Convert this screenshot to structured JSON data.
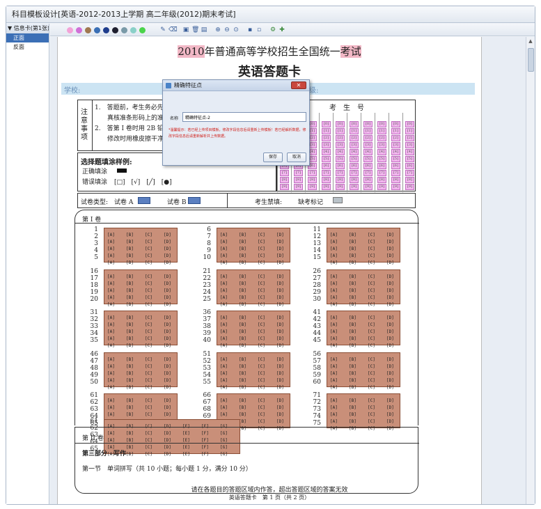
{
  "window": {
    "title": "科目模板设计[英语-2012-2013上学期 高二年级(2012)期末考试]"
  },
  "sidebar": {
    "header": "▼ 信息卡(第1张)",
    "items": [
      {
        "label": "正面",
        "selected": true
      },
      {
        "label": "反面",
        "selected": false
      }
    ]
  },
  "toolbar": {
    "colors": [
      "#f3a3d8",
      "#d070d8",
      "#a07850",
      "#3a6fb5",
      "#1f3d8c",
      "#1f1f2f",
      "#7a9aa8",
      "#8ad0c8",
      "#4bd44b"
    ],
    "icons": [
      "pencil-icon",
      "eraser-icon",
      "folder-icon",
      "trash-icon",
      "delete-icon",
      "zoom-in-icon",
      "zoom-out-icon",
      "zoom-fit-icon",
      "save-icon",
      "save-as-icon",
      "settings-icon",
      "add-icon"
    ]
  },
  "sheet": {
    "title_year": "2010",
    "title_main": "年普通高等学校招生全国统一",
    "title_tail": "考试",
    "subtitle": "英语答题卡",
    "school_label": "学校:",
    "class_label": "班级:",
    "notice_title": "注意事项",
    "notice_lines": [
      "1.　答题前，考生务必先",
      "　　真核准条形码上的准",
      "2.　答第 I 卷时用 2B 铅",
      "　　修改时用橡皮擦干净"
    ],
    "exam_no_title": "考　生　号",
    "sample_title": "选择题填涂样例:",
    "sample_correct": "正确填涂",
    "sample_wrong": "错误填涂",
    "sample_wrong_marks": "[□]　[√]　[╱]　[●]",
    "type_label": "试卷类型:",
    "type_a": "试卷 A",
    "type_b": "试卷 B",
    "forbid_label": "考生禁填:",
    "absent_label": "缺考标记",
    "part1_title": "第 I 卷",
    "part2_title": "第 II 卷",
    "part3_title": "第三部分　写作",
    "section1": "第一节　单词拼写（共 10 小题；每小题 1 分，满分 10 分）",
    "bottom_note": "请在各题目的答题区域内作答，超出答题区域的答案无效",
    "footer": "英语答题卡　第 1 页（共 2 页）",
    "options_abcd": [
      "[A]",
      "[B]",
      "[C]",
      "[D]"
    ],
    "options_abcdefg": [
      "[A]",
      "[B]",
      "[C]",
      "[D]",
      "[E]",
      "[F]",
      "[G]"
    ]
  },
  "dialog": {
    "title": "精确特征点",
    "name_label": "名称",
    "name_value": "精确特征点-2",
    "warning": "*温馨提示：若已经上传项目模板，修改字段信息后请重新上传模板！若已经解析数据，修改字段信息后请重新解析并上传数据。",
    "save": "保存",
    "cancel": "取消"
  }
}
